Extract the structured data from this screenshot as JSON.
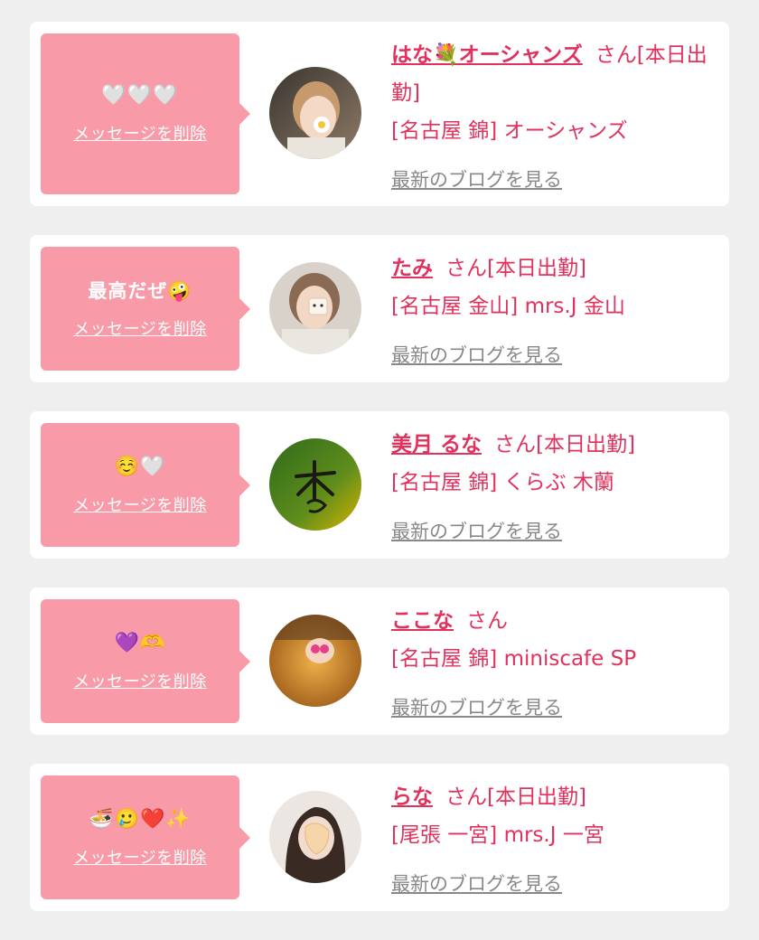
{
  "delete_label": "メッセージを削除",
  "blog_label": "最新のブログを見る",
  "honorific": "さん",
  "cards": [
    {
      "message": "🤍🤍🤍",
      "name": "はな💐オーシャンズ",
      "status": "[本日出勤]",
      "shop": "[名古屋 錦] オーシャンズ",
      "avatar_icon": "profile-photo"
    },
    {
      "message": "最高だぜ🤪",
      "name": "たみ",
      "status": "[本日出勤]",
      "shop": "[名古屋 金山] mrs.J 金山",
      "avatar_icon": "profile-photo"
    },
    {
      "message": "☺️🤍",
      "name": "美月 るな",
      "status": "[本日出勤]",
      "shop": "[名古屋 錦] くらぶ 木蘭",
      "avatar_icon": "shop-logo"
    },
    {
      "message": "💜🫶",
      "name": "ここな",
      "status": "",
      "shop": "[名古屋 錦] miniscafe SP",
      "avatar_icon": "profile-photo"
    },
    {
      "message": "🍜🥲❤️✨",
      "name": "らな",
      "status": "[本日出勤]",
      "shop": "[尾張 一宮] mrs.J 一宮",
      "avatar_icon": "profile-photo"
    }
  ],
  "colors": {
    "page_bg": "#efefef",
    "card_bg": "#ffffff",
    "bubble": "#f99aa8",
    "accent": "#e0325d",
    "link_gray": "#888888"
  }
}
